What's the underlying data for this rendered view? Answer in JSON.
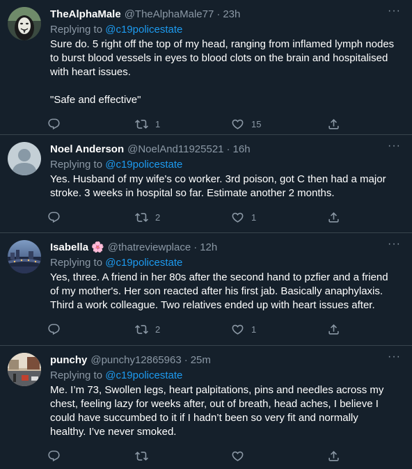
{
  "tweets": [
    {
      "name": "TheAlphaMale",
      "emoji": "",
      "handle": "@TheAlphaMale77",
      "time": "23h",
      "replying_prefix": "Replying to ",
      "replying_to": "@c19policestate",
      "text": "Sure do. 5 right off the top of my head, ranging from inflamed lymph nodes to burst blood vessels in eyes to blood clots on the brain and hospitalised with heart issues.\n\n\"Safe and effective\"",
      "retweets": "1",
      "likes": "15",
      "avatar_icon": "masked-face-avatar"
    },
    {
      "name": "Noel Anderson",
      "emoji": "",
      "handle": "@NoelAnd11925521",
      "time": "16h",
      "replying_prefix": "Replying to ",
      "replying_to": "@c19policestate",
      "text": "Yes. Husband of my wife's co worker. 3rd poison, got C then had a major stroke. 3 weeks in hospital so far. Estimate another 2 months.",
      "retweets": "2",
      "likes": "1",
      "avatar_icon": "default-person-avatar"
    },
    {
      "name": "Isabella",
      "emoji": "🌸",
      "handle": "@thatreviewplace",
      "time": "12h",
      "replying_prefix": "Replying to ",
      "replying_to": "@c19policestate",
      "text": "Yes, three. A friend in her 80s after the second hand to pzfier and a friend of my mother's. Her son reacted after his first jab. Basically anaphylaxis. Third a work colleague. Two relatives ended up with heart issues after.",
      "retweets": "2",
      "likes": "1",
      "avatar_icon": "city-night-avatar"
    },
    {
      "name": "punchy",
      "emoji": "",
      "handle": "@punchy12865963",
      "time": "25m",
      "replying_prefix": "Replying to ",
      "replying_to": "@c19policestate",
      "text": "Me. I’m 73, Swollen legs, heart palpitations, pins and needles across my chest, feeling lazy for weeks after, out of breath, head aches, I believe I could have succumbed to it if I hadn’t been so very fit and normally healthy. I’ve never smoked.",
      "retweets": "",
      "likes": "",
      "avatar_icon": "street-scene-avatar"
    }
  ],
  "colors": {
    "background": "#15202b",
    "divider": "#38444d",
    "muted": "#8b98a5",
    "link": "#1d9bf0"
  }
}
